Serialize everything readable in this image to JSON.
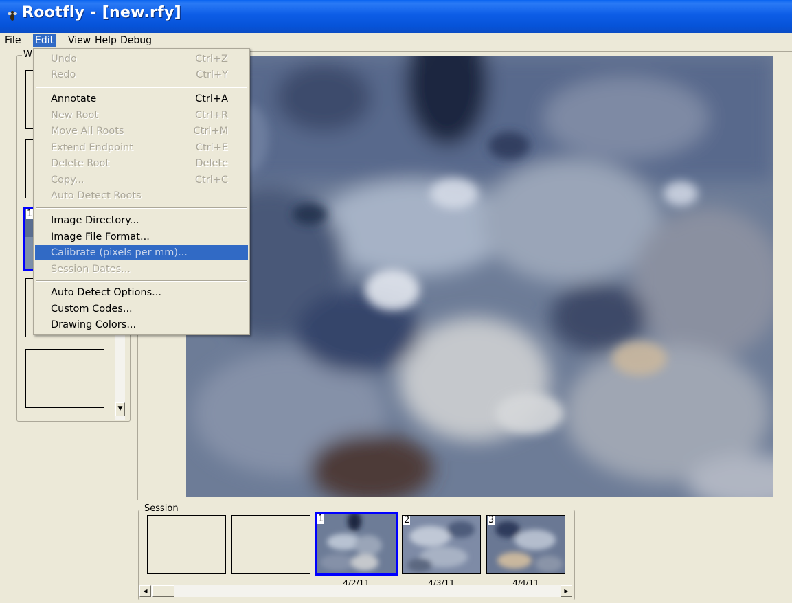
{
  "window": {
    "title": "Rootfly - [new.rfy]",
    "app_icon": "fly-icon"
  },
  "menubar": {
    "items": [
      {
        "label": "File"
      },
      {
        "label": "Edit",
        "active": true
      },
      {
        "label": "View"
      },
      {
        "label": "Help"
      },
      {
        "label": "Debug"
      }
    ]
  },
  "edit_menu": {
    "items": [
      {
        "label": "Undo",
        "shortcut": "Ctrl+Z",
        "enabled": false
      },
      {
        "label": "Redo",
        "shortcut": "Ctrl+Y",
        "enabled": false
      },
      {
        "label": "Annotate",
        "shortcut": "Ctrl+A",
        "enabled": true
      },
      {
        "label": "New Root",
        "shortcut": "Ctrl+R",
        "enabled": false
      },
      {
        "label": "Move All Roots",
        "shortcut": "Ctrl+M",
        "enabled": false
      },
      {
        "label": "Extend Endpoint",
        "shortcut": "Ctrl+E",
        "enabled": false
      },
      {
        "label": "Delete Root",
        "shortcut": "Delete",
        "enabled": false
      },
      {
        "label": "Copy...",
        "shortcut": "Ctrl+C",
        "enabled": false
      },
      {
        "label": "Auto Detect Roots",
        "shortcut": "",
        "enabled": false
      },
      {
        "label": "Image Directory...",
        "shortcut": "",
        "enabled": true
      },
      {
        "label": "Image File Format...",
        "shortcut": "",
        "enabled": true
      },
      {
        "label": "Calibrate (pixels per mm)...",
        "shortcut": "",
        "enabled": false,
        "highlighted": true
      },
      {
        "label": "Session Dates...",
        "shortcut": "",
        "enabled": false
      },
      {
        "label": "Auto Detect Options...",
        "shortcut": "",
        "enabled": true
      },
      {
        "label": "Custom Codes...",
        "shortcut": "",
        "enabled": true
      },
      {
        "label": "Drawing Colors...",
        "shortcut": "",
        "enabled": true
      }
    ]
  },
  "window_panel": {
    "caption": "W",
    "selected_number": "1"
  },
  "session": {
    "caption": "Session",
    "thumbnails": [
      {
        "number": "",
        "date": ""
      },
      {
        "number": "",
        "date": ""
      },
      {
        "number": "1",
        "date": "4/2/11",
        "selected": true
      },
      {
        "number": "2",
        "date": "4/3/11"
      },
      {
        "number": "3",
        "date": "4/4/11"
      }
    ]
  },
  "colors": {
    "titlebar": "#0a5ce8",
    "highlight": "#316ac5",
    "selection_border": "#0000ff",
    "face": "#ece9d8"
  }
}
